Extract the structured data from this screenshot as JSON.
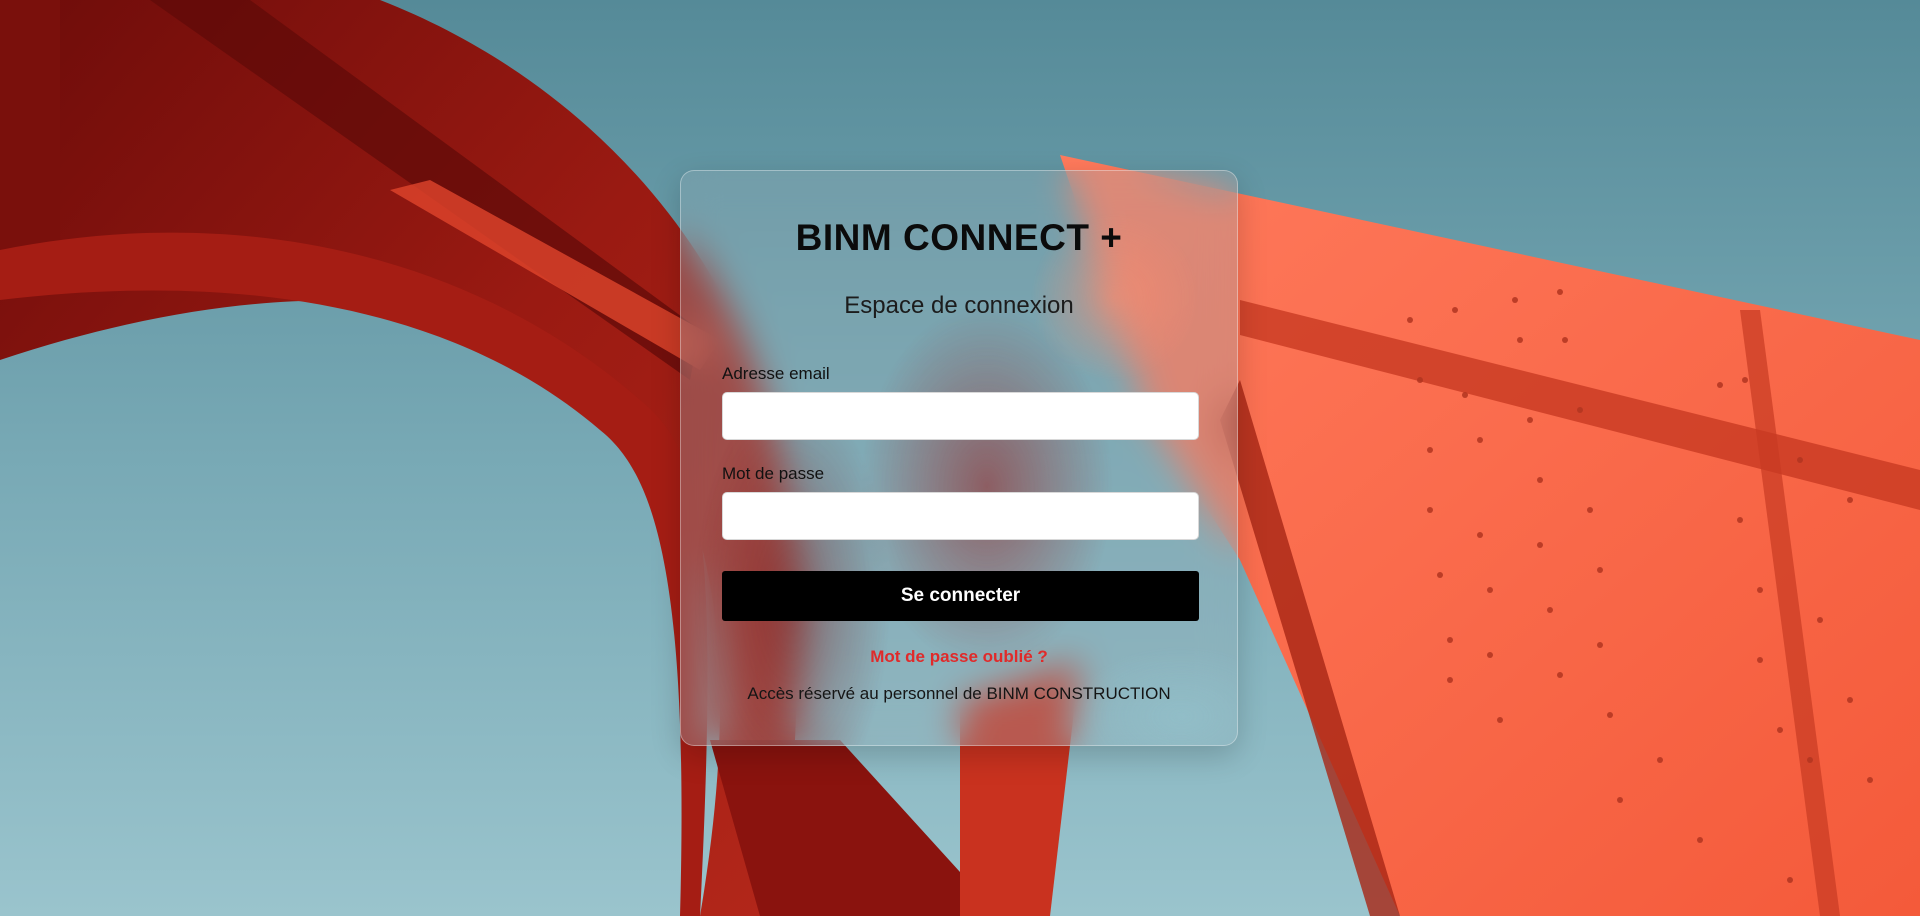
{
  "app": {
    "title": "BINM CONNECT +",
    "subtitle": "Espace de connexion"
  },
  "form": {
    "email_label": "Adresse email",
    "email_value": "",
    "email_placeholder": "",
    "password_label": "Mot de passe",
    "password_value": "",
    "password_placeholder": "",
    "submit_label": "Se connecter",
    "forgot_label": "Mot de passe oublié ?",
    "notice": "Accès réservé au personnel de BINM CONSTRUCTION"
  },
  "colors": {
    "sky": "#6d9eab",
    "sculpture_dark": "#8e150f",
    "sculpture_bright": "#f0603f",
    "button": "#000000",
    "link": "#e02a2a"
  },
  "background": {
    "description_icon": "red-steel-sculpture-image"
  }
}
